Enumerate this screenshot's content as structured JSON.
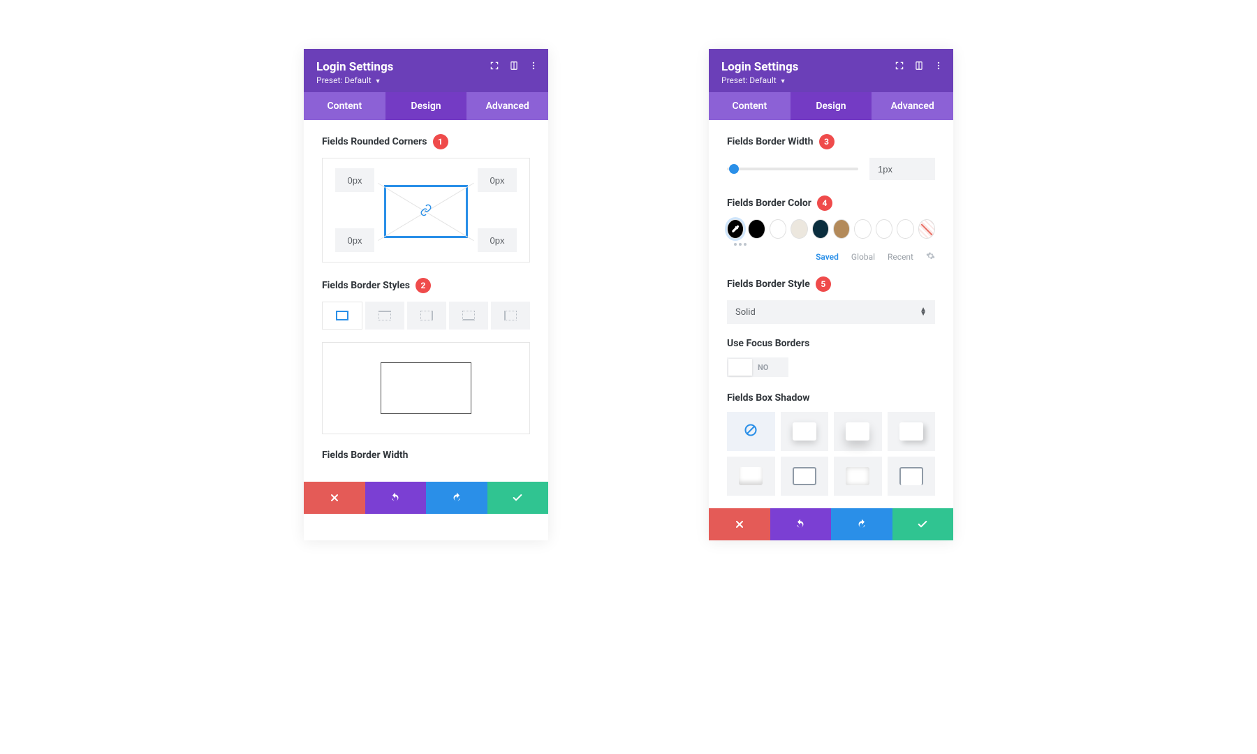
{
  "header": {
    "title": "Login Settings",
    "preset_label": "Preset:",
    "preset_value": "Default"
  },
  "tabs": {
    "content": "Content",
    "design": "Design",
    "advanced": "Advanced"
  },
  "left": {
    "rounded_corners_label": "Fields Rounded Corners",
    "callout1": "1",
    "corner_tl": "0px",
    "corner_tr": "0px",
    "corner_bl": "0px",
    "corner_br": "0px",
    "border_styles_label": "Fields Border Styles",
    "callout2": "2",
    "border_width_label": "Fields Border Width"
  },
  "right": {
    "border_width_label": "Fields Border Width",
    "callout3": "3",
    "border_width_value": "1px",
    "border_color_label": "Fields Border Color",
    "callout4": "4",
    "color_tabs": {
      "saved": "Saved",
      "global": "Global",
      "recent": "Recent"
    },
    "swatches": [
      "#000000",
      "#000000",
      "#ffffff",
      "#ece7de",
      "#0b2e3e",
      "#b38a5a",
      "#ffffff",
      "#ffffff",
      "#ffffff"
    ],
    "border_style_label": "Fields Border Style",
    "callout5": "5",
    "border_style_value": "Solid",
    "use_focus_label": "Use Focus Borders",
    "toggle_no": "NO",
    "box_shadow_label": "Fields Box Shadow"
  }
}
